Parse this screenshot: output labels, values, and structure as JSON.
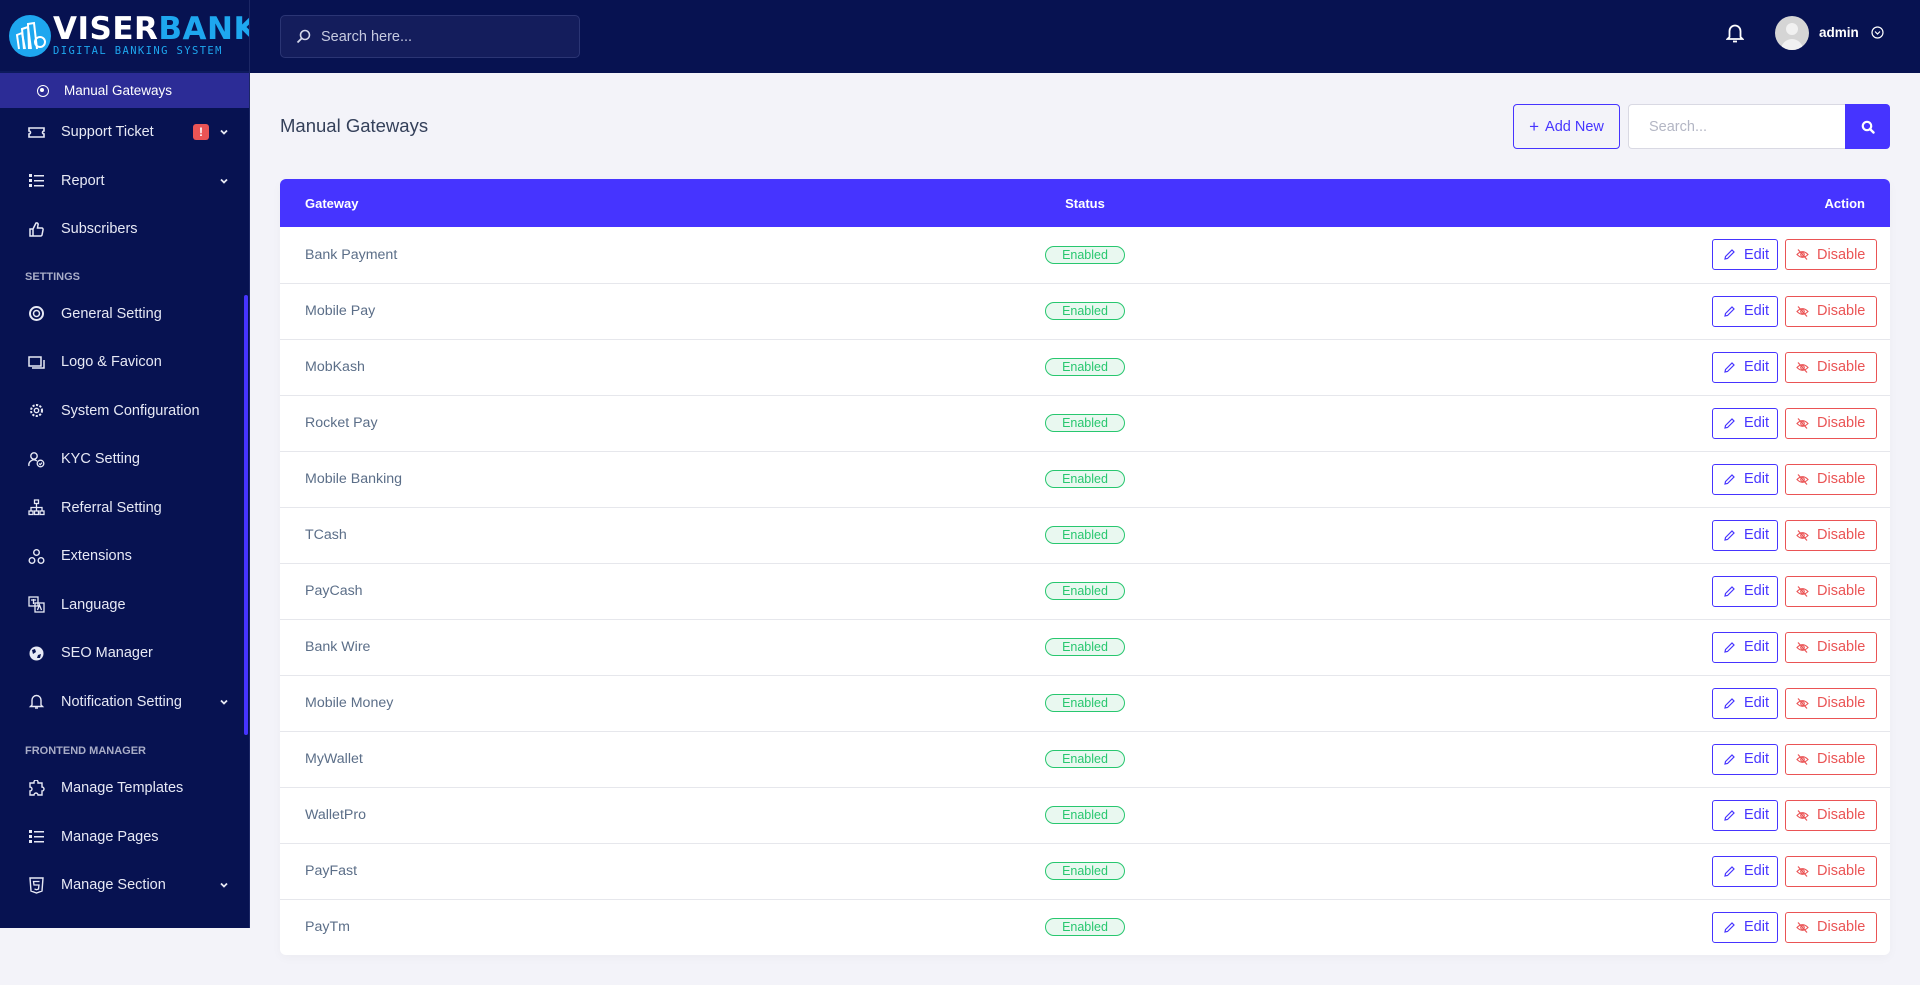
{
  "brand": {
    "name_part1": "VISER",
    "name_part2": "BANK",
    "tagline": "DIGITAL BANKING SYSTEM"
  },
  "sidebar": {
    "active_item": {
      "label": "Manual Gateways",
      "icon": "dot-circle-icon"
    },
    "items": [
      {
        "label": "Support Ticket",
        "icon": "ticket-icon",
        "badge": "!",
        "has_submenu": true
      },
      {
        "label": "Report",
        "icon": "list-icon",
        "has_submenu": true
      },
      {
        "label": "Subscribers",
        "icon": "thumbs-up-icon",
        "has_submenu": false
      }
    ],
    "sections": [
      {
        "title": "SETTINGS",
        "items": [
          {
            "label": "General Setting",
            "icon": "life-ring-icon",
            "has_submenu": false
          },
          {
            "label": "Logo & Favicon",
            "icon": "images-icon",
            "has_submenu": false
          },
          {
            "label": "System Configuration",
            "icon": "gear-icon",
            "has_submenu": false
          },
          {
            "label": "KYC Setting",
            "icon": "user-check-icon",
            "has_submenu": false
          },
          {
            "label": "Referral Setting",
            "icon": "sitemap-icon",
            "has_submenu": false
          },
          {
            "label": "Extensions",
            "icon": "cubes-icon",
            "has_submenu": false
          },
          {
            "label": "Language",
            "icon": "language-icon",
            "has_submenu": false
          },
          {
            "label": "SEO Manager",
            "icon": "globe-icon",
            "has_submenu": false
          },
          {
            "label": "Notification Setting",
            "icon": "bell-icon",
            "has_submenu": true
          }
        ]
      },
      {
        "title": "FRONTEND MANAGER",
        "items": [
          {
            "label": "Manage Templates",
            "icon": "puzzle-icon",
            "has_submenu": false
          },
          {
            "label": "Manage Pages",
            "icon": "list-icon",
            "has_submenu": false
          },
          {
            "label": "Manage Section",
            "icon": "html5-icon",
            "has_submenu": true
          }
        ]
      }
    ]
  },
  "topbar": {
    "search_placeholder": "Search here...",
    "user_name": "admin"
  },
  "page": {
    "title": "Manual Gateways",
    "add_new_label": "Add New",
    "search_placeholder": "Search..."
  },
  "table": {
    "columns": [
      "Gateway",
      "Status",
      "Action"
    ],
    "edit_label": "Edit",
    "disable_label": "Disable",
    "rows": [
      {
        "gateway": "Bank Payment",
        "status": "Enabled"
      },
      {
        "gateway": "Mobile Pay",
        "status": "Enabled"
      },
      {
        "gateway": "MobKash",
        "status": "Enabled"
      },
      {
        "gateway": "Rocket Pay",
        "status": "Enabled"
      },
      {
        "gateway": "Mobile Banking",
        "status": "Enabled"
      },
      {
        "gateway": "TCash",
        "status": "Enabled"
      },
      {
        "gateway": "PayCash",
        "status": "Enabled"
      },
      {
        "gateway": "Bank Wire",
        "status": "Enabled"
      },
      {
        "gateway": "Mobile Money",
        "status": "Enabled"
      },
      {
        "gateway": "MyWallet",
        "status": "Enabled"
      },
      {
        "gateway": "WalletPro",
        "status": "Enabled"
      },
      {
        "gateway": "PayFast",
        "status": "Enabled"
      },
      {
        "gateway": "PayTm",
        "status": "Enabled"
      }
    ]
  },
  "colors": {
    "primary": "#4634ff",
    "sidebar_bg": "#071251",
    "danger": "#ea5455",
    "success": "#28c76f",
    "brand_blue": "#1ea7ef"
  }
}
